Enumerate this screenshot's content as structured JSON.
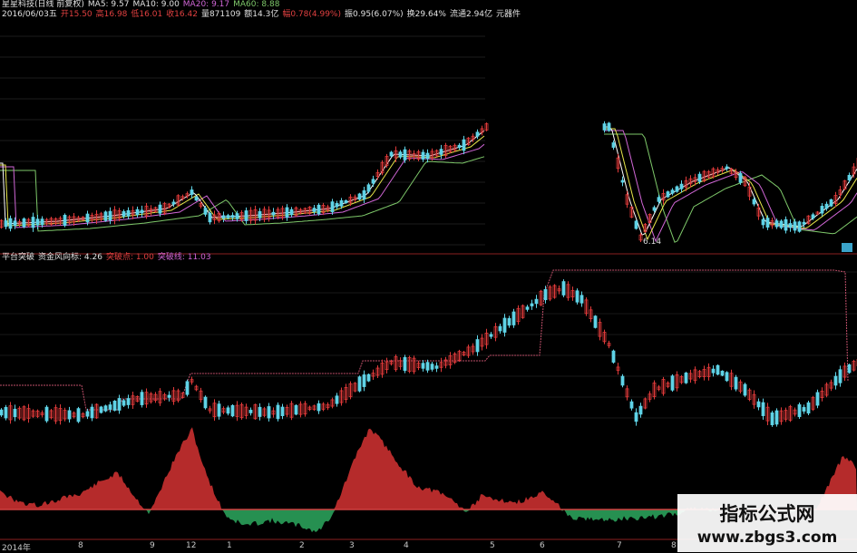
{
  "header": {
    "row1": [
      {
        "text": "星星科技(日线 前复权)",
        "color": "#e0e0e0"
      },
      {
        "text": "MA5: 9.57",
        "color": "#e0e0e0"
      },
      {
        "text": "MA10: 9.00",
        "color": "#e0e0e0"
      },
      {
        "text": "MA20: 9.17",
        "color": "#d066d6"
      },
      {
        "text": "MA60: 8.88",
        "color": "#7ec86a"
      }
    ],
    "row2": [
      {
        "text": "2016/06/03五",
        "color": "#e0e0e0"
      },
      {
        "text": "开15.50",
        "color": "#e04040"
      },
      {
        "text": "高16.98",
        "color": "#e04040"
      },
      {
        "text": "低16.01",
        "color": "#e04040"
      },
      {
        "text": "收16.42",
        "color": "#e04040"
      },
      {
        "text": "量871109",
        "color": "#e0e0e0"
      },
      {
        "text": "额14.3亿",
        "color": "#e0e0e0"
      },
      {
        "text": "幅0.78(4.99%)",
        "color": "#e04040"
      },
      {
        "text": "振0.95(6.07%)",
        "color": "#e0e0e0"
      },
      {
        "text": "换29.64%",
        "color": "#e0e0e0"
      },
      {
        "text": "流通2.94亿",
        "color": "#e0e0e0"
      },
      {
        "text": "元器件",
        "color": "#e0e0e0"
      }
    ]
  },
  "price_chart": {
    "low_label": "6.14"
  },
  "indicator": {
    "row": [
      {
        "text": "平台突破",
        "color": "#e0e0e0"
      },
      {
        "text": "资金风向标: 4.26",
        "color": "#e0e0e0"
      },
      {
        "text": "突破点: 1.00",
        "color": "#e04040"
      },
      {
        "text": "突破线: 11.03",
        "color": "#d066d6"
      }
    ]
  },
  "axis": {
    "labels": [
      "2014年",
      "8",
      "9",
      "12",
      "1",
      "2",
      "3",
      "4",
      "5",
      "6",
      "7",
      "8"
    ]
  },
  "watermark": {
    "title": "指标公式网",
    "url": "www.zbgs3.com"
  },
  "colors": {
    "up": "#e03a3a",
    "down": "#5fd3e6",
    "ma5": "#ffffff",
    "ma10": "#e8e84a",
    "ma20": "#d066d6",
    "ma60": "#7ec86a",
    "breakout": "#c0506a",
    "fill_red": "#c93030",
    "fill_green": "#2aa05a"
  }
}
